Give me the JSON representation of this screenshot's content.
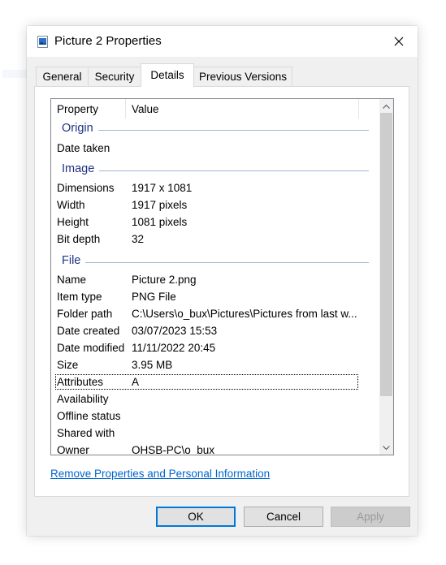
{
  "dialog": {
    "title": "Picture 2 Properties"
  },
  "icons": {
    "title": "picture-file-icon",
    "close": "close-icon",
    "scroll_up": "chevron-up-icon",
    "scroll_down": "chevron-down-icon"
  },
  "tabs": [
    {
      "label": "General"
    },
    {
      "label": "Security"
    },
    {
      "label": "Details"
    },
    {
      "label": "Previous Versions"
    }
  ],
  "columns": {
    "property": "Property",
    "value": "Value"
  },
  "groups": {
    "origin": "Origin",
    "image": "Image",
    "file": "File"
  },
  "rows": {
    "date_taken": {
      "name": "Date taken",
      "value": ""
    },
    "dimensions": {
      "name": "Dimensions",
      "value": "1917 x 1081"
    },
    "width": {
      "name": "Width",
      "value": "1917 pixels"
    },
    "height": {
      "name": "Height",
      "value": "1081 pixels"
    },
    "bit_depth": {
      "name": "Bit depth",
      "value": "32"
    },
    "name": {
      "name": "Name",
      "value": "Picture 2.png"
    },
    "item_type": {
      "name": "Item type",
      "value": "PNG File"
    },
    "folder_path": {
      "name": "Folder path",
      "value": "C:\\Users\\o_bux\\Pictures\\Pictures from last w..."
    },
    "date_created": {
      "name": "Date created",
      "value": "03/07/2023 15:53"
    },
    "date_modified": {
      "name": "Date modified",
      "value": "11/11/2022 20:45"
    },
    "size": {
      "name": "Size",
      "value": "3.95 MB"
    },
    "attributes": {
      "name": "Attributes",
      "value": "A"
    },
    "availability": {
      "name": "Availability",
      "value": ""
    },
    "offline_status": {
      "name": "Offline status",
      "value": ""
    },
    "shared_with": {
      "name": "Shared with",
      "value": ""
    },
    "owner": {
      "name": "Owner",
      "value": "OHSB-PC\\o_bux"
    }
  },
  "remove_link": "Remove Properties and Personal Information",
  "buttons": {
    "ok": "OK",
    "cancel": "Cancel",
    "apply": "Apply"
  }
}
